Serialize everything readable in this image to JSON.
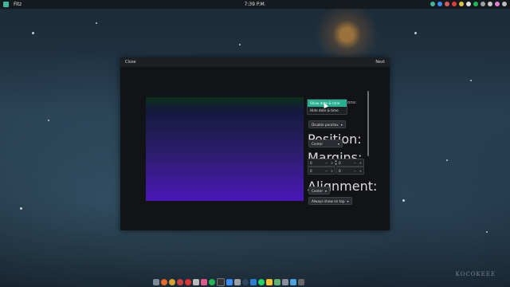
{
  "topbar": {
    "app_name": "Fitz",
    "clock": "7:39 P.M.",
    "tray_icons": [
      "pin-icon",
      "messenger-icon",
      "music-icon",
      "youtube-icon",
      "notes-icon",
      "ghost-icon",
      "spotify-icon",
      "link-icon",
      "cloud-icon",
      "color-icon",
      "network-icon"
    ]
  },
  "dialog": {
    "close_label": "Close",
    "next_label": "Next",
    "partial_heading": "ons:",
    "popup_options": [
      "Show date & time",
      "Hide date & time"
    ],
    "parallax_button": "Disable parallax",
    "position_label": "Position:",
    "position_value": "Center",
    "margins_label": "Margins:",
    "margins": [
      "0",
      "0",
      "0",
      "0"
    ],
    "alignment_label": "Alignment:",
    "alignment_value": "Center",
    "ontop_button": "Always show on top"
  },
  "dock": {
    "apps": [
      "files-app",
      "firefox-app",
      "chrome-app",
      "vivaldi-app",
      "opera-app",
      "screenshot-app",
      "music-app",
      "spotify-app",
      "terminal-app",
      "mail-app",
      "settings-app",
      "steam-app",
      "code-app",
      "whatsapp-app",
      "store-app",
      "monitor-app",
      "chat-app",
      "photos-app",
      "system-app"
    ]
  },
  "watermark": "KOCOKEEE",
  "colors": {
    "accent": "#27b08f",
    "dialog_bg": "#121316"
  }
}
